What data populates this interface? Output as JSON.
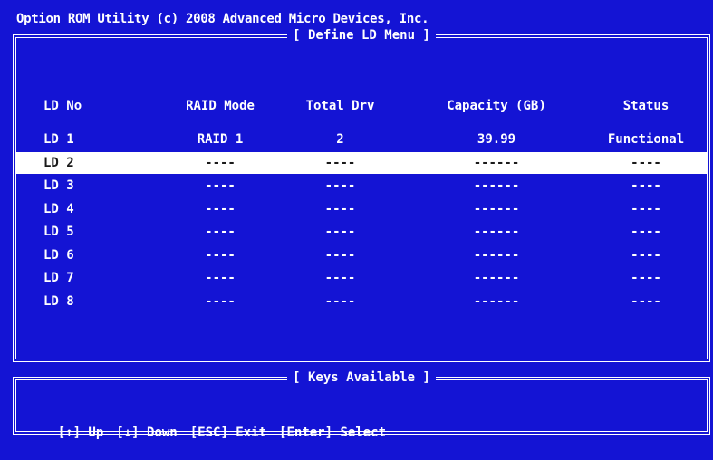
{
  "app_title": "Option ROM Utility (c) 2008 Advanced Micro Devices, Inc.",
  "menu_title": "[ Define LD Menu ]",
  "keys_title": "[ Keys Available ]",
  "columns": [
    "LD No",
    "RAID Mode",
    "Total Drv",
    "Capacity (GB)",
    "Status"
  ],
  "rows": [
    [
      "LD 1",
      "RAID 1",
      "2",
      "39.99",
      "Functional"
    ],
    [
      "LD 2",
      "----",
      "----",
      "------",
      "----"
    ],
    [
      "LD 3",
      "----",
      "----",
      "------",
      "----"
    ],
    [
      "LD 4",
      "----",
      "----",
      "------",
      "----"
    ],
    [
      "LD 5",
      "----",
      "----",
      "------",
      "----"
    ],
    [
      "LD 6",
      "----",
      "----",
      "------",
      "----"
    ],
    [
      "LD 7",
      "----",
      "----",
      "------",
      "----"
    ],
    [
      "LD 8",
      "----",
      "----",
      "------",
      "----"
    ]
  ],
  "selected_row": 1,
  "keys": [
    "[↑] Up",
    "[↓] Down",
    "[ESC] Exit",
    "[Enter] Select"
  ],
  "colors": {
    "background": "#1414d4",
    "text": "#ffffff",
    "highlight": "#ffffff"
  }
}
